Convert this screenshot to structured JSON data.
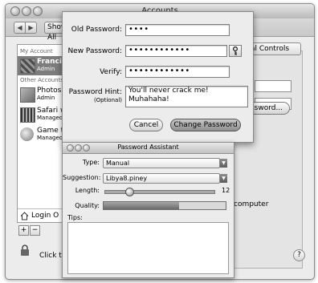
{
  "window": {
    "title": "Accounts"
  },
  "toolbar": {
    "back_label": "◀",
    "forward_label": "▶",
    "show_all_label": "Show All"
  },
  "sidebar": {
    "my_account_label": "My Account",
    "other_accounts_label": "Other Accounts",
    "accounts": [
      {
        "name": "Francis",
        "role": "Admin",
        "selected": true
      },
      {
        "name": "Photos",
        "role": "Admin",
        "selected": false
      },
      {
        "name": "Safari w",
        "role": "Managed",
        "selected": false
      },
      {
        "name": "Game ti",
        "role": "Managed",
        "selected": false
      }
    ],
    "login_options_label": "Login O",
    "add_label": "+",
    "remove_label": "−"
  },
  "panel": {
    "tab_label": "al Controls",
    "password_button_label": "ssword...",
    "computer_text": "computer"
  },
  "footer": {
    "lock_text": "Click the l",
    "help_label": "?"
  },
  "sheet": {
    "old_password_label": "Old Password:",
    "old_password_value": "••••",
    "new_password_label": "New Password:",
    "new_password_value": "••••••••••••",
    "verify_label": "Verify:",
    "verify_value": "••••••••••••",
    "hint_label": "Password Hint:",
    "hint_sublabel": "(Optional)",
    "hint_value": "You'll never crack me! Muhahaha!",
    "cancel_label": "Cancel",
    "change_label": "Change Password"
  },
  "assistant": {
    "title": "Password Assistant",
    "type_label": "Type:",
    "type_value": "Manual",
    "suggestion_label": "Suggestion:",
    "suggestion_value": "Libya8.piney",
    "length_label": "Length:",
    "length_value": "12",
    "length_fraction": 0.2,
    "quality_label": "Quality:",
    "quality_fraction": 0.62,
    "tips_label": "Tips:"
  }
}
